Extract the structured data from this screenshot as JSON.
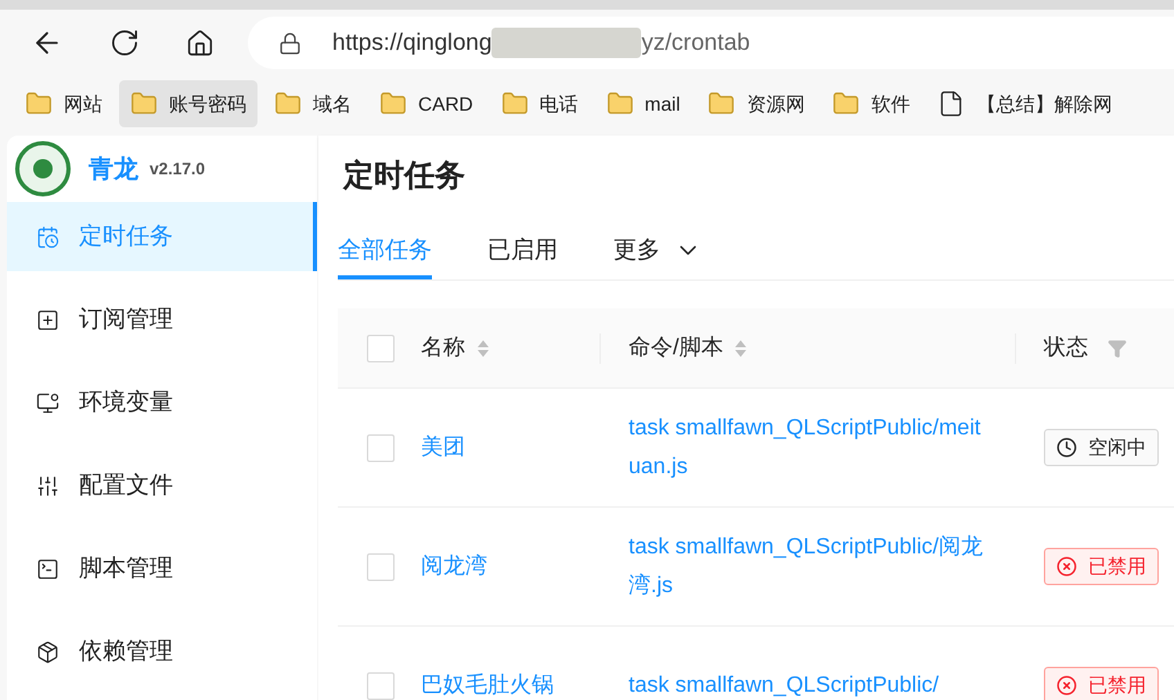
{
  "browser": {
    "url_start": "https://qinglong",
    "url_end": "yz/crontab",
    "bookmarks": [
      {
        "label": "网站",
        "kind": "folder",
        "selected": false
      },
      {
        "label": "账号密码",
        "kind": "folder",
        "selected": true
      },
      {
        "label": "域名",
        "kind": "folder",
        "selected": false
      },
      {
        "label": "CARD",
        "kind": "folder",
        "selected": false
      },
      {
        "label": "电话",
        "kind": "folder",
        "selected": false
      },
      {
        "label": "mail",
        "kind": "folder",
        "selected": false
      },
      {
        "label": "资源网",
        "kind": "folder",
        "selected": false
      },
      {
        "label": "软件",
        "kind": "folder",
        "selected": false
      },
      {
        "label": "【总结】解除网",
        "kind": "page",
        "selected": false
      }
    ]
  },
  "sidebar": {
    "brand": "青龙",
    "version": "v2.17.0",
    "items": [
      {
        "label": "定时任务",
        "selected": true
      },
      {
        "label": "订阅管理",
        "selected": false
      },
      {
        "label": "环境变量",
        "selected": false
      },
      {
        "label": "配置文件",
        "selected": false
      },
      {
        "label": "脚本管理",
        "selected": false
      },
      {
        "label": "依赖管理",
        "selected": false
      }
    ]
  },
  "page": {
    "title": "定时任务",
    "tabs": [
      {
        "label": "全部任务",
        "selected": true
      },
      {
        "label": "已启用",
        "selected": false
      },
      {
        "label": "更多",
        "selected": false
      }
    ],
    "table": {
      "select_all_checked": false,
      "columns": [
        "名称",
        "命令/脚本",
        "状态"
      ],
      "rows": [
        {
          "name": "美团",
          "command": "task smallfawn_QLScriptPublic/meituan.js",
          "status": "空闲中",
          "kind": "idle",
          "checked": false
        },
        {
          "name": "阅龙湾",
          "command": "task smallfawn_QLScriptPublic/阅龙湾.js",
          "status": "已禁用",
          "kind": "disabled",
          "checked": false
        },
        {
          "name": "巴奴毛肚火锅",
          "command": "task smallfawn_QLScriptPublic/",
          "status": "已禁用",
          "kind": "disabled",
          "checked": false
        }
      ]
    }
  }
}
